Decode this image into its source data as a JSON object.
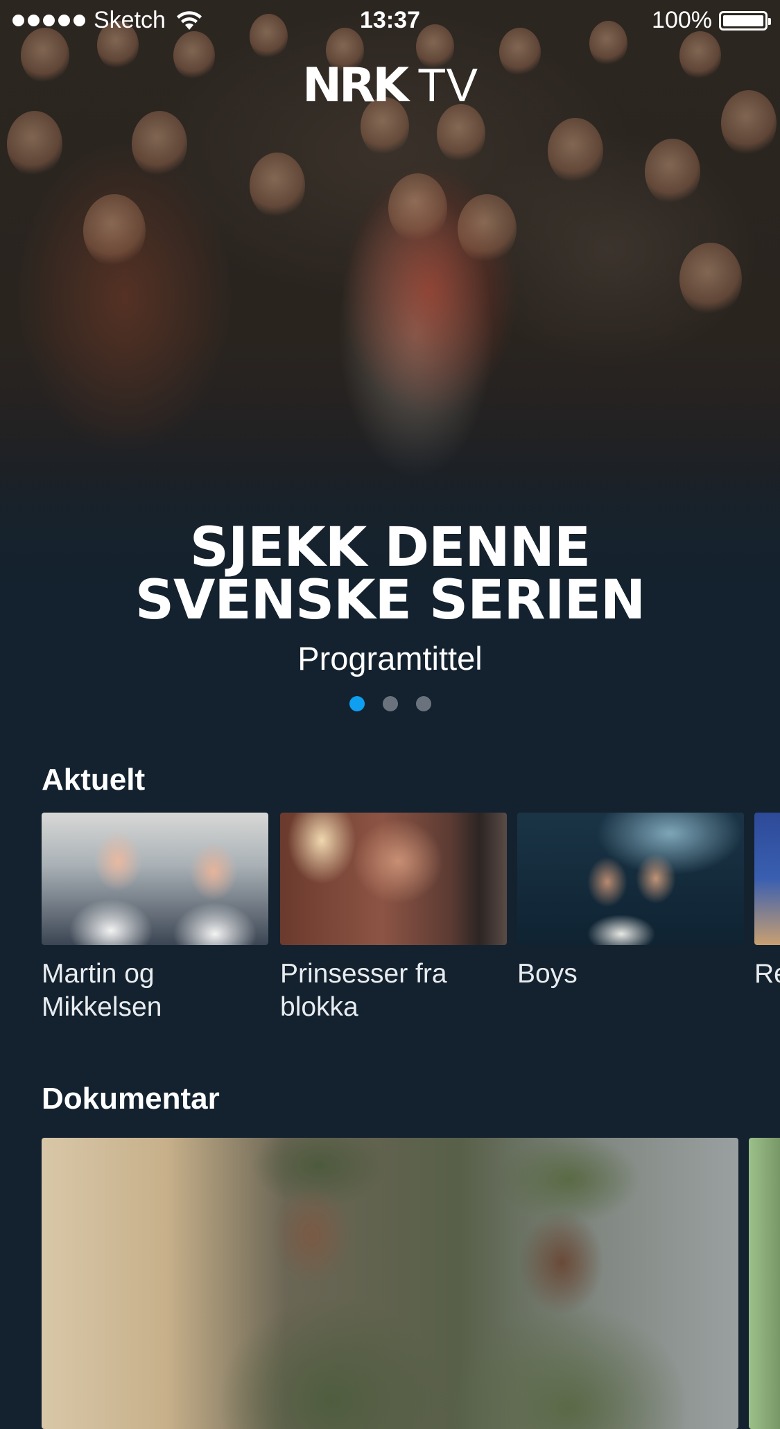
{
  "status_bar": {
    "carrier": "Sketch",
    "time": "13:37",
    "battery": "100%"
  },
  "logo": {
    "brand": "NRK",
    "suffix": "TV"
  },
  "hero": {
    "title_line1": "SJEKK DENNE",
    "title_line2": "SVENSKE SERIEN",
    "subtitle": "Programtittel",
    "pages": 3,
    "active_page": 1
  },
  "sections": [
    {
      "title": "Aktuelt",
      "items": [
        {
          "title": "Martin og Mikkelsen"
        },
        {
          "title": "Prinsesser fra blokka"
        },
        {
          "title": "Boys"
        },
        {
          "title": "Re m"
        }
      ]
    },
    {
      "title": "Dokumentar"
    }
  ],
  "colors": {
    "background": "#14222f",
    "accent": "#0e9ff0",
    "pager_inactive": "#6a737d"
  }
}
